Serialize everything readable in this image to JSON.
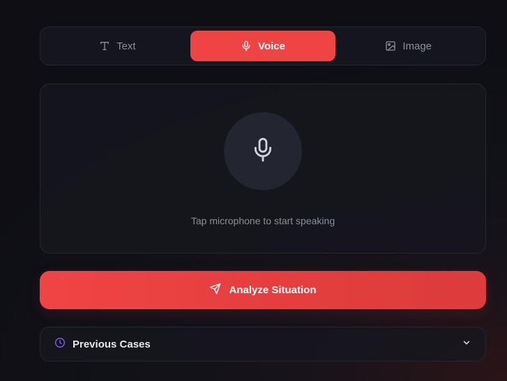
{
  "tabs": [
    {
      "label": "Text",
      "icon": "text-icon",
      "active": false
    },
    {
      "label": "Voice",
      "icon": "microphone-icon",
      "active": true
    },
    {
      "label": "Image",
      "icon": "image-icon",
      "active": false
    }
  ],
  "voice": {
    "hint": "Tap microphone to start speaking",
    "icon": "microphone-icon"
  },
  "actions": {
    "analyze_label": "Analyze Situation",
    "analyze_icon": "send-icon"
  },
  "previous_cases": {
    "label": "Previous Cases",
    "icon": "clock-icon",
    "toggle_icon": "chevron-down-icon",
    "expanded": false
  },
  "colors": {
    "accent": "#ef4444",
    "clock": "#8b5cf6",
    "muted_text": "#8b8f99"
  }
}
